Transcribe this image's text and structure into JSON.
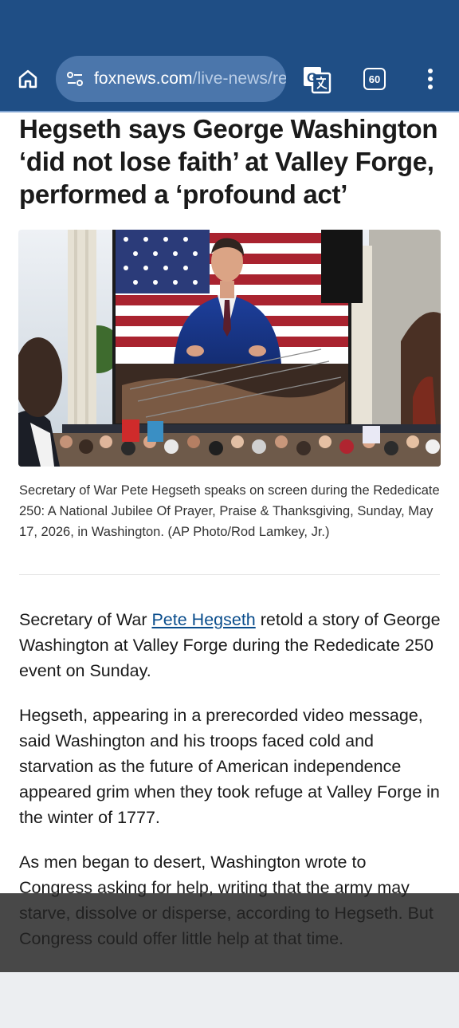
{
  "browser": {
    "url_domain": "foxnews.com",
    "url_path": "/live-news/re",
    "tab_count": "60",
    "icons": {
      "home": "home-icon",
      "site_settings": "tune-icon",
      "translate": "translate-icon",
      "tabs": "tab-switcher-icon",
      "menu": "more-vert-icon"
    },
    "colors": {
      "toolbar": "#1f4e85",
      "urlbar": "#4b76ab"
    }
  },
  "article": {
    "headline": "Hegseth says George Washington ‘did not lose faith’ at Valley Forge, performed a ‘profound act’",
    "image_caption": "Secretary of War Pete Hegseth speaks on screen during the Rededicate 250: A National Jubilee Of Prayer, Praise & Thanksgiving, Sunday, May 17, 2026, in Washington. (AP Photo/Rod Lamkey, Jr.)",
    "p1_before": "Secretary of War ",
    "p1_link": "Pete Hegseth",
    "p1_after": " retold a story of George Washington at Valley Forge during the Rededicate 250 event on Sunday.",
    "p2": "Hegseth, appearing in a prerecorded video message, said Washington and his troops faced cold and starvation as the future of American independence appeared grim when they took refuge at Valley Forge in the winter of 1777.",
    "p3": "As men began to desert, Washington wrote to Congress asking for help, writing that the army may starve, dissolve or disperse, according to Hegseth. But Congress could offer little help at that time.",
    "link_color": "#0a4d8c"
  }
}
